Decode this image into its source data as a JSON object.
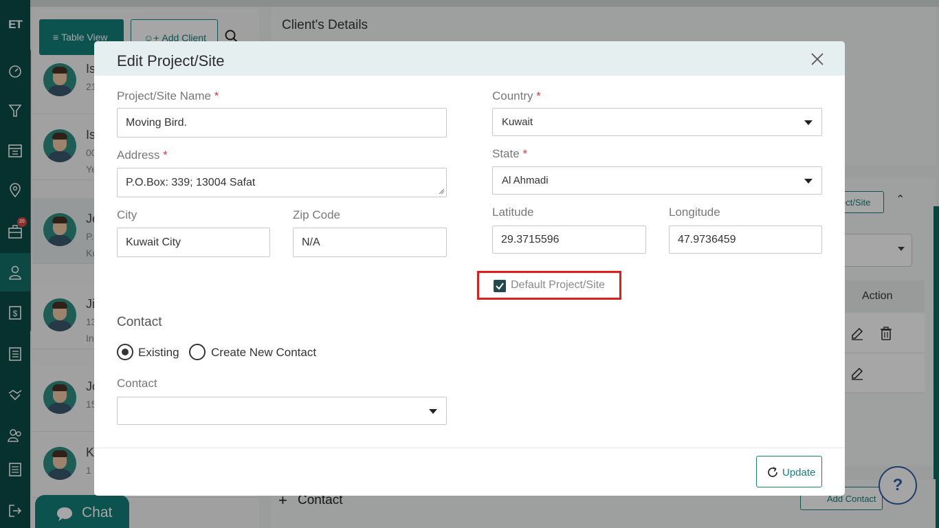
{
  "rail": {
    "logo": "ET",
    "notification_count": "20",
    "icons": [
      "dashboard-icon",
      "funnel-icon",
      "calendar-icon",
      "location-icon",
      "briefcase-icon",
      "user-icon",
      "invoice-icon",
      "list-icon",
      "handshake-icon",
      "team-icon",
      "settings-sliders-icon",
      "logout-icon"
    ]
  },
  "toolbar": {
    "table_view_label": "Table View",
    "add_client_label": "Add Client"
  },
  "client_list": [
    {
      "name": "Is",
      "line1": "21",
      "line2": ""
    },
    {
      "name": "Is",
      "line1": "00",
      "line2": "Ye"
    },
    {
      "name": "Je",
      "line1": "P.",
      "line2": "Ku"
    },
    {
      "name": "Ji",
      "line1": "13",
      "line2": "In"
    },
    {
      "name": "Jo",
      "line1": "15",
      "line2": ""
    },
    {
      "name": "K",
      "line1": "1",
      "line2": ""
    }
  ],
  "details": {
    "title": "Client's Details",
    "project_button_label": "ect/Site",
    "action_header": "Action",
    "contact_label": "Contact",
    "add_contact_label": "Add Contact",
    "help_label": "?"
  },
  "chat": {
    "label": "Chat"
  },
  "modal": {
    "title": "Edit Project/Site",
    "project_name": {
      "label": "Project/Site Name",
      "required": "*",
      "value": "Moving Bird."
    },
    "address": {
      "label": "Address",
      "required": "*",
      "value": "P.O.Box: 339; 13004 Safat"
    },
    "city": {
      "label": "City",
      "value": "Kuwait City"
    },
    "zip": {
      "label": "Zip Code",
      "value": "N/A"
    },
    "country": {
      "label": "Country",
      "required": "*",
      "value": "Kuwait"
    },
    "state": {
      "label": "State",
      "required": "*",
      "value": "Al Ahmadi"
    },
    "latitude": {
      "label": "Latitude",
      "value": "29.3715596"
    },
    "longitude": {
      "label": "Longitude",
      "value": "47.9736459"
    },
    "default_checkbox": {
      "label": "Default Project/Site",
      "checked": true
    },
    "contact_section": {
      "title": "Contact",
      "option_existing": "Existing",
      "option_new": "Create New Contact",
      "selected": "Existing",
      "contact_label": "Contact",
      "contact_value": ""
    },
    "update_label": "Update"
  },
  "colors": {
    "rail": "#0b4c48",
    "accent": "#13807a",
    "highlight_box": "#e01d1d",
    "required": "#d83b3b"
  }
}
